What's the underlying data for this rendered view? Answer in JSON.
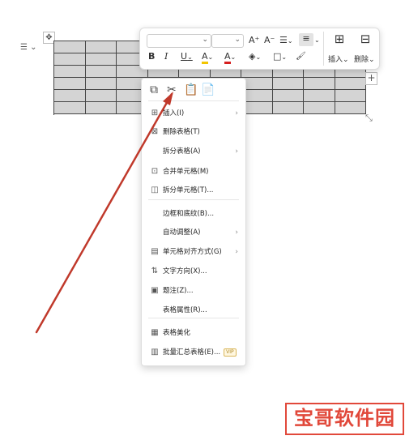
{
  "table": {
    "rows": 6,
    "cols": 10
  },
  "handles": {
    "move": "✥",
    "menu": "☰",
    "add": "+",
    "resize": "⤡"
  },
  "toolbar": {
    "font_family_value": "",
    "font_size_value": "",
    "increase_font": "A⁺",
    "decrease_font": "A⁻",
    "line_spacing": "☰",
    "align": "≡",
    "bold": "B",
    "italic": "I",
    "underline": "U",
    "highlight": "A",
    "font_color": "A",
    "fill": "◈",
    "border": "□",
    "format_brush": "🖌",
    "insert_label": "插入",
    "delete_label": "删除",
    "highlight_color": "#f2c500",
    "font_color_color": "#d61f1f"
  },
  "context_menu": {
    "quick_actions": [
      "copy",
      "cut",
      "paste",
      "paste-special"
    ],
    "items": [
      {
        "label": "插入(I)",
        "icon": "insert-table-icon",
        "arrow": true
      },
      {
        "label": "删除表格(T)",
        "icon": "delete-table-icon",
        "arrow": false
      },
      {
        "label": "拆分表格(A)",
        "icon": "",
        "arrow": true
      },
      {
        "label": "合并单元格(M)",
        "icon": "merge-cells-icon",
        "arrow": false
      },
      {
        "label": "拆分单元格(T)...",
        "icon": "split-cells-icon",
        "arrow": false
      },
      {
        "label": "边框和底纹(B)...",
        "icon": "",
        "arrow": false
      },
      {
        "label": "自动调整(A)",
        "icon": "",
        "arrow": true
      },
      {
        "label": "单元格对齐方式(G)",
        "icon": "cell-align-icon",
        "arrow": true
      },
      {
        "label": "文字方向(X)...",
        "icon": "text-direction-icon",
        "arrow": false
      },
      {
        "label": "题注(Z)...",
        "icon": "caption-icon",
        "arrow": false
      },
      {
        "label": "表格属性(R)...",
        "icon": "",
        "arrow": false
      },
      {
        "label": "表格美化",
        "icon": "table-beautify-icon",
        "arrow": false
      },
      {
        "label": "批量汇总表格(E)...",
        "icon": "batch-summary-icon",
        "arrow": false,
        "badge": "VIP"
      }
    ]
  },
  "annotation": {
    "arrow_color": "#c0392b"
  },
  "watermark": {
    "text": "宝哥软件园",
    "color": "#e1483a"
  }
}
